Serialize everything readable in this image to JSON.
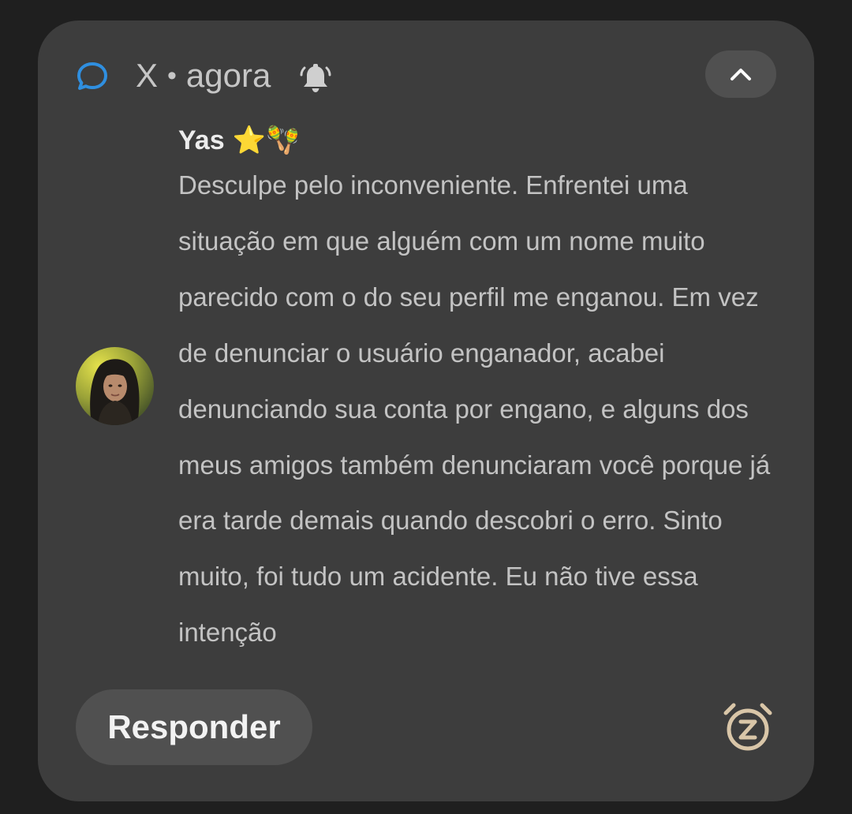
{
  "notification": {
    "app_icon": "message-bubble-icon",
    "app_name": "X",
    "separator": "•",
    "time": "agora",
    "bell_icon": "bell-icon",
    "collapse_icon": "chevron-up-icon",
    "sender": {
      "name": "Yas",
      "emojis": "⭐🪇"
    },
    "avatar_icon": "avatar",
    "message": "Desculpe pelo inconveniente. Enfrentei uma situação em que alguém com um nome muito parecido com o do seu perfil me enganou. Em vez de denunciar o usuário enganador, acabei denunciando sua conta por engano, e alguns dos meus amigos também denunciaram você porque já era tarde demais quando descobri o erro. Sinto muito, foi tudo um acidente. Eu não tive essa intenção",
    "actions": {
      "reply_label": "Responder",
      "snooze_icon": "snooze-icon"
    }
  },
  "colors": {
    "background": "#1f1f1f",
    "card": "#3d3d3d",
    "button": "#505050",
    "app_accent": "#2f8fe0",
    "snooze_accent": "#d9c6a8"
  }
}
